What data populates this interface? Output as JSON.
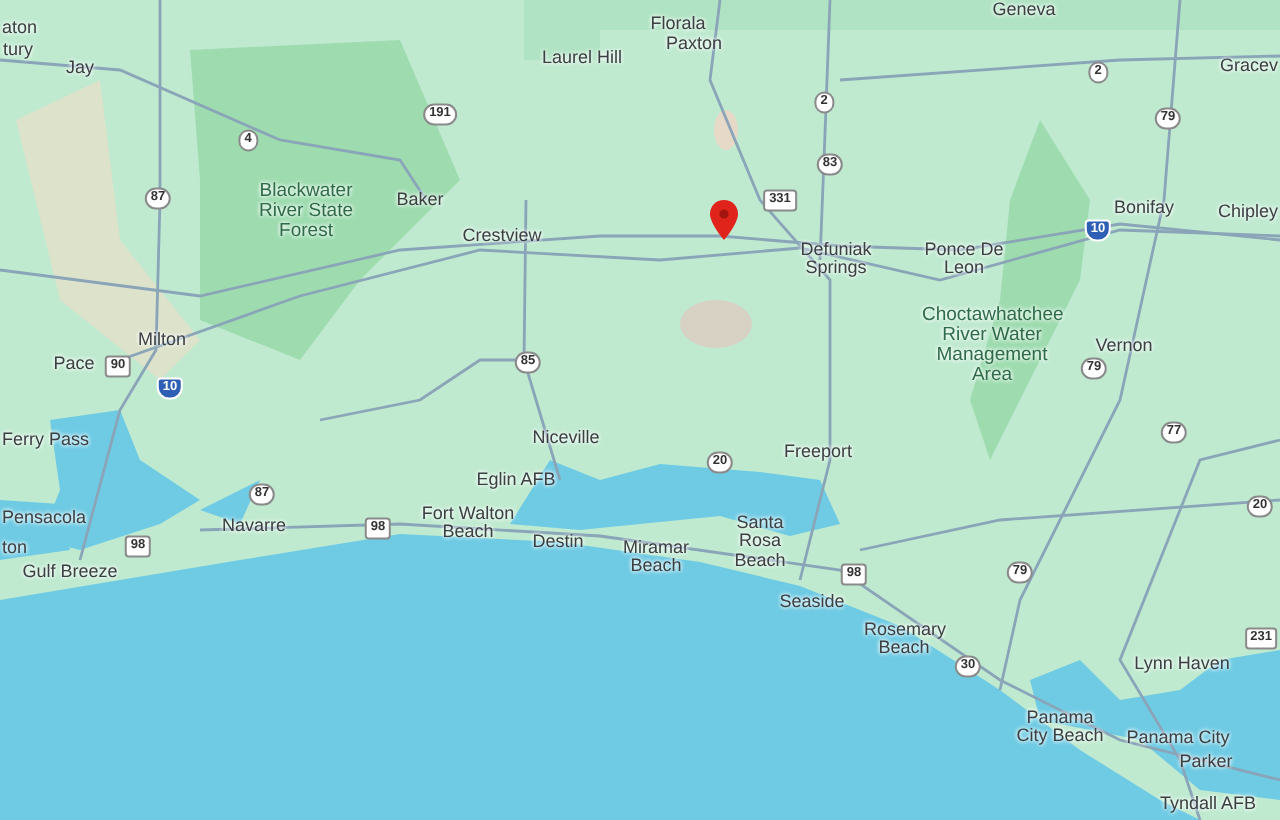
{
  "map": {
    "places": [
      {
        "name": "aton",
        "kind": "town"
      },
      {
        "name": "Florala",
        "kind": "town"
      },
      {
        "name": "Geneva",
        "kind": "town"
      },
      {
        "name": "tury",
        "kind": "town"
      },
      {
        "name": "Jay",
        "kind": "town"
      },
      {
        "name": "Laurel Hill",
        "kind": "town"
      },
      {
        "name": "Paxton",
        "kind": "town"
      },
      {
        "name": "Gracev",
        "kind": "town"
      },
      {
        "name": "Blackwater River State Forest",
        "kind": "area"
      },
      {
        "name": "Baker",
        "kind": "town"
      },
      {
        "name": "Bonifay",
        "kind": "town"
      },
      {
        "name": "Chipley",
        "kind": "town"
      },
      {
        "name": "Crestview",
        "kind": "town"
      },
      {
        "name": "Defuniak Springs",
        "kind": "town"
      },
      {
        "name": "Ponce De Leon",
        "kind": "town"
      },
      {
        "name": "Milton",
        "kind": "town"
      },
      {
        "name": "Choctawhatchee River Water Management Area",
        "kind": "area"
      },
      {
        "name": "Vernon",
        "kind": "town"
      },
      {
        "name": "Pace",
        "kind": "town"
      },
      {
        "name": "Ferry Pass",
        "kind": "town"
      },
      {
        "name": "Niceville",
        "kind": "town"
      },
      {
        "name": "Freeport",
        "kind": "town"
      },
      {
        "name": "Eglin AFB",
        "kind": "town"
      },
      {
        "name": "Pensacola",
        "kind": "town"
      },
      {
        "name": "Navarre",
        "kind": "town"
      },
      {
        "name": "Fort Walton Beach",
        "kind": "town"
      },
      {
        "name": "ton",
        "kind": "town"
      },
      {
        "name": "Destin",
        "kind": "town"
      },
      {
        "name": "Santa Rosa Beach",
        "kind": "town"
      },
      {
        "name": "Gulf Breeze",
        "kind": "town"
      },
      {
        "name": "Miramar Beach",
        "kind": "town"
      },
      {
        "name": "Seaside",
        "kind": "town"
      },
      {
        "name": "Rosemary Beach",
        "kind": "town"
      },
      {
        "name": "Lynn Haven",
        "kind": "town"
      },
      {
        "name": "Panama City Beach",
        "kind": "town"
      },
      {
        "name": "Panama City",
        "kind": "town"
      },
      {
        "name": "Parker",
        "kind": "town"
      },
      {
        "name": "Tyndall AFB",
        "kind": "town"
      }
    ],
    "shields": [
      {
        "number": "2",
        "kind": "state"
      },
      {
        "number": "191",
        "kind": "state"
      },
      {
        "number": "2",
        "kind": "state"
      },
      {
        "number": "79",
        "kind": "state"
      },
      {
        "number": "4",
        "kind": "state"
      },
      {
        "number": "83",
        "kind": "state"
      },
      {
        "number": "87",
        "kind": "state"
      },
      {
        "number": "331",
        "kind": "us"
      },
      {
        "number": "10",
        "kind": "interstate"
      },
      {
        "number": "90",
        "kind": "us"
      },
      {
        "number": "85",
        "kind": "state"
      },
      {
        "number": "79",
        "kind": "state"
      },
      {
        "number": "10",
        "kind": "interstate"
      },
      {
        "number": "77",
        "kind": "state"
      },
      {
        "number": "20",
        "kind": "state"
      },
      {
        "number": "87",
        "kind": "state"
      },
      {
        "number": "20",
        "kind": "state"
      },
      {
        "number": "98",
        "kind": "us"
      },
      {
        "number": "98",
        "kind": "us"
      },
      {
        "number": "98",
        "kind": "us"
      },
      {
        "number": "79",
        "kind": "state"
      },
      {
        "number": "231",
        "kind": "us"
      },
      {
        "number": "30",
        "kind": "state"
      }
    ]
  }
}
